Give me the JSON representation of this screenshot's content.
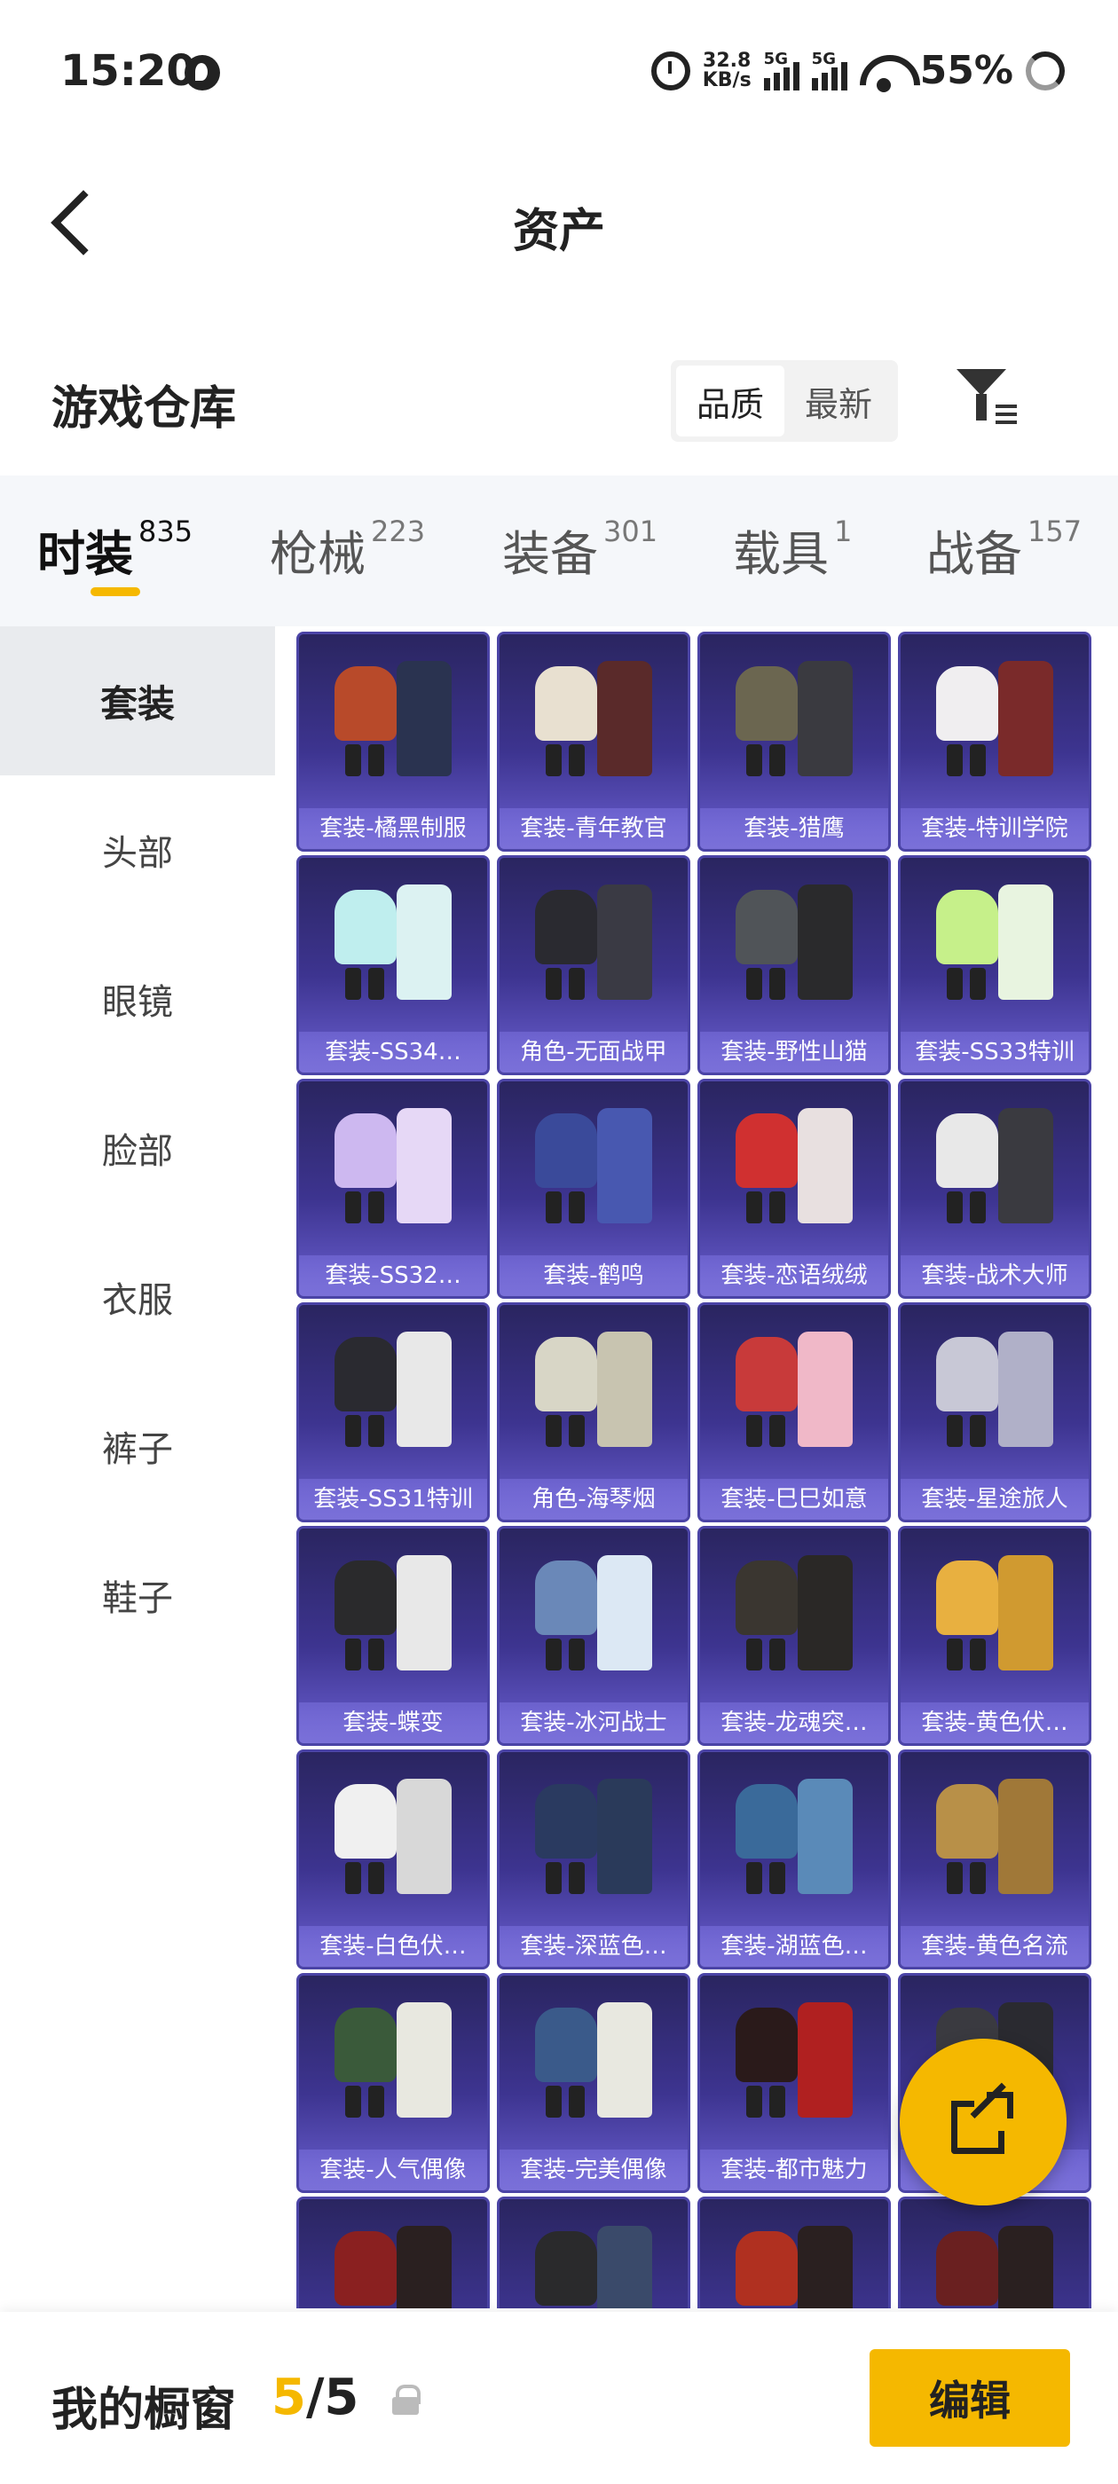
{
  "status_bar": {
    "time": "15:20",
    "speed_value": "32.8",
    "speed_unit": "KB/s",
    "signal1_label": "5G",
    "signal2_label": "5G",
    "battery": "55%"
  },
  "nav": {
    "title": "资产"
  },
  "section": {
    "title": "游戏仓库",
    "sort_options": [
      "品质",
      "最新"
    ]
  },
  "tabs": [
    {
      "label": "时装",
      "count": "835"
    },
    {
      "label": "枪械",
      "count": "223"
    },
    {
      "label": "装备",
      "count": "301"
    },
    {
      "label": "载具",
      "count": "1"
    },
    {
      "label": "战备",
      "count": "157"
    }
  ],
  "sidebar": [
    "套装",
    "头部",
    "眼镜",
    "脸部",
    "衣服",
    "裤子",
    "鞋子"
  ],
  "items": [
    "套装-橘黑制服",
    "套装-青年教官",
    "套装-猎鹰",
    "套装-特训学院",
    "套装-SS34…",
    "角色-无面战甲",
    "套装-野性山猫",
    "套装-SS33特训",
    "套装-SS32…",
    "套装-鹤鸣",
    "套装-恋语绒绒",
    "套装-战术大师",
    "套装-SS31特训",
    "角色-海琴烟",
    "套装-巳巳如意",
    "套装-星途旅人",
    "套装-蝶变",
    "套装-冰河战士",
    "套装-龙魂突…",
    "套装-黄色伏…",
    "套装-白色伏…",
    "套装-深蓝色…",
    "套装-湖蓝色…",
    "套装-黄色名流",
    "套装-人气偶像",
    "套装-完美偶像",
    "套装-都市魅力",
    "导",
    "",
    "",
    "",
    ""
  ],
  "bottom": {
    "title": "我的橱窗",
    "current": "5",
    "separator": "/",
    "total": "5",
    "edit_label": "编辑"
  },
  "colors": {
    "accent": "#f5b800",
    "card_top": "#2a2560",
    "card_bottom": "#6a5fd0"
  },
  "icons": [
    "signal-icon",
    "alarm-icon",
    "wifi-icon",
    "back-arrow-icon",
    "filter-icon",
    "share-icon",
    "lock-icon"
  ]
}
